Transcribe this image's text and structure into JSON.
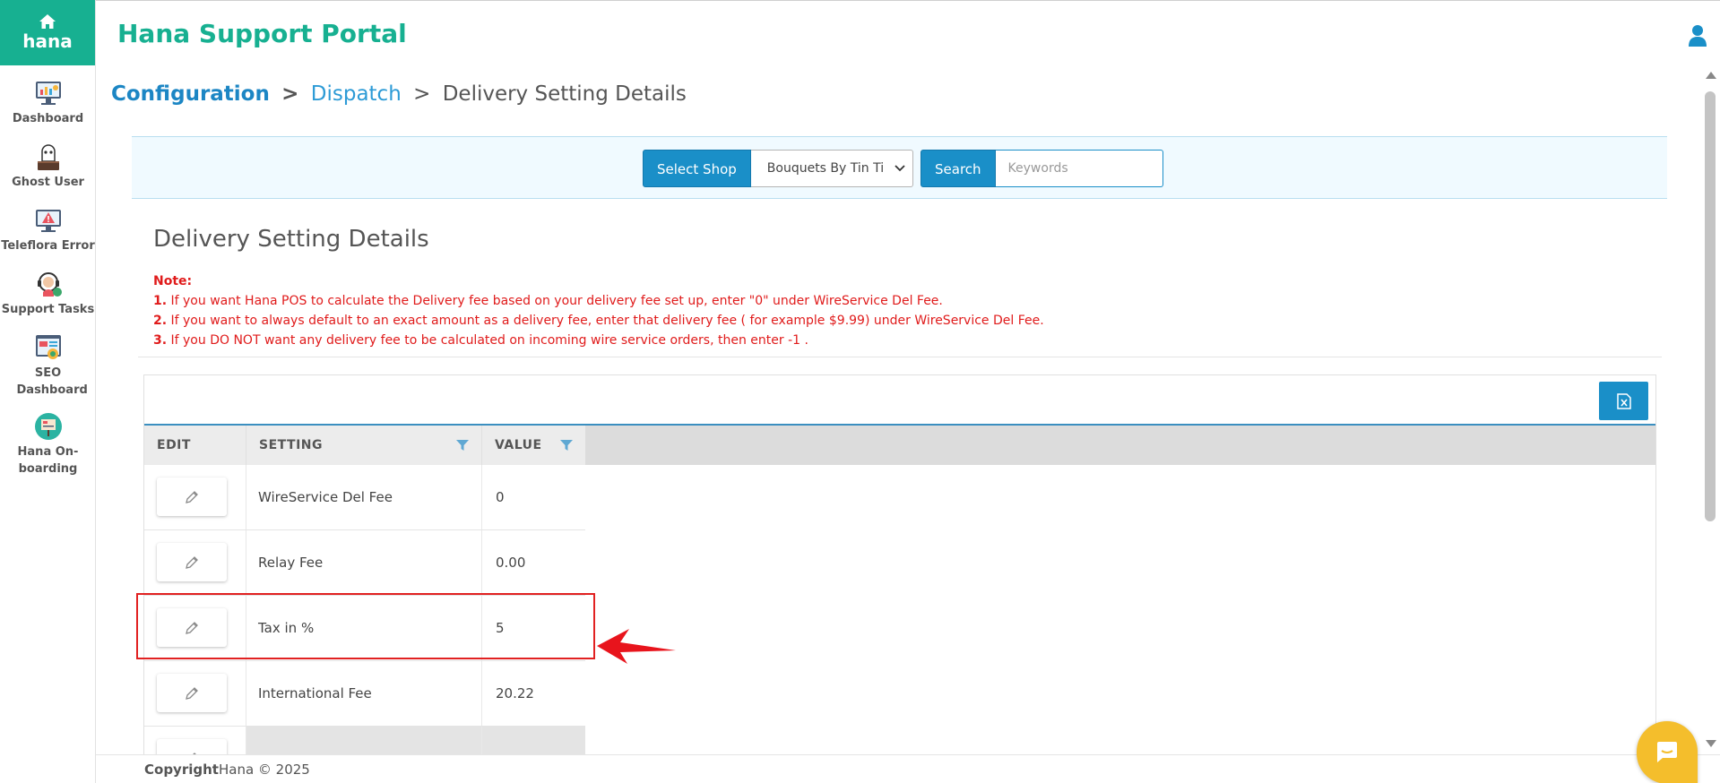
{
  "sidebar": {
    "brand": "hana",
    "items": [
      {
        "label": "Dashboard",
        "icon": "dashboard-icon"
      },
      {
        "label": "Ghost User",
        "icon": "ghost-user-icon"
      },
      {
        "label": "Teleflora Error",
        "icon": "teleflora-error-icon"
      },
      {
        "label": "Support Tasks",
        "icon": "support-tasks-icon"
      },
      {
        "label": "SEO Dashboard",
        "icon": "seo-dashboard-icon"
      },
      {
        "label": "Hana On-boarding",
        "icon": "hana-onboarding-icon"
      }
    ]
  },
  "header": {
    "title": "Hana Support Portal",
    "user_icon": "user-icon"
  },
  "breadcrumb": {
    "items": [
      "Configuration",
      "Dispatch",
      "Delivery Setting Details"
    ],
    "separator": ">"
  },
  "filters": {
    "select_shop_label": "Select Shop",
    "shop_value": "Bouquets By Tin Ti",
    "search_label": "Search",
    "search_placeholder": "Keywords"
  },
  "section": {
    "title": "Delivery Setting Details",
    "note_heading": "Note:",
    "notes": [
      {
        "num": "1.",
        "text": "If you want Hana POS to calculate the Delivery fee based on your delivery fee set up, enter \"0\" under WireService Del Fee."
      },
      {
        "num": "2.",
        "text": "If you want to always default to an exact amount as a delivery fee, enter that delivery fee ( for example $9.99) under WireService Del Fee."
      },
      {
        "num": "3.",
        "text": "If you DO NOT want any delivery fee to be calculated on incoming wire service orders, then enter -1 ."
      }
    ]
  },
  "grid": {
    "columns": [
      "EDIT",
      "SETTING",
      "VALUE"
    ],
    "rows": [
      {
        "setting": "WireService Del Fee",
        "value": "0"
      },
      {
        "setting": "Relay Fee",
        "value": "0.00"
      },
      {
        "setting": "Tax in %",
        "value": "5"
      },
      {
        "setting": "International Fee",
        "value": "20.22"
      },
      {
        "setting": "",
        "value": ""
      }
    ],
    "highlighted_row": "Tax in %"
  },
  "footer": {
    "copyright_label": "Copyright",
    "copyright_text": "Hana © 2025"
  },
  "colors": {
    "brand": "#17b091",
    "primary": "#1a8fc8",
    "note": "#e01b1b",
    "highlight": "#e12121",
    "chat": "#f4be2c"
  }
}
